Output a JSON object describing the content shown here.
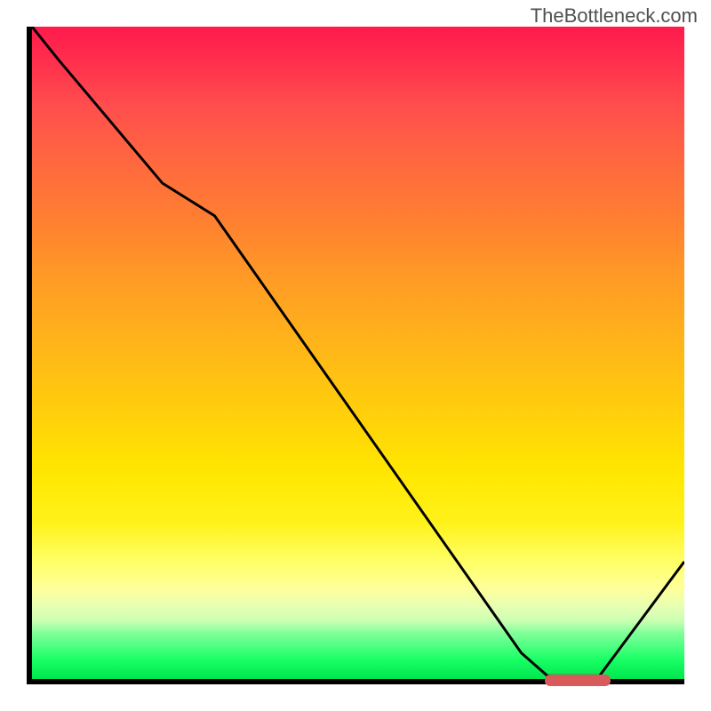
{
  "watermark": "TheBottleneck.com",
  "chart_data": {
    "type": "line",
    "title": "",
    "xlabel": "",
    "ylabel": "",
    "x": [
      0,
      4,
      20,
      28,
      75,
      79,
      87,
      100
    ],
    "values": [
      100,
      95,
      76,
      71,
      4,
      0.5,
      0.5,
      18
    ],
    "xlim": [
      0,
      100
    ],
    "ylim": [
      0,
      100
    ],
    "marker": {
      "x_start": 78,
      "x_end": 88,
      "y": 0.5,
      "color": "#d85a5a"
    },
    "gradient_colors": {
      "top": "#ff1a4d",
      "mid_upper": "#ff9926",
      "mid": "#ffe600",
      "mid_lower": "#ffff99",
      "bottom": "#00e64d"
    }
  }
}
